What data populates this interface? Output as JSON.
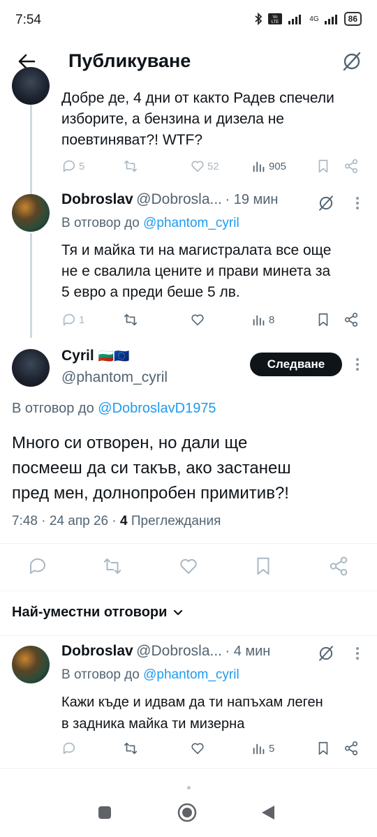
{
  "status_bar": {
    "time": "7:54",
    "network": "4G",
    "battery": "86"
  },
  "header": {
    "title": "Публикуване"
  },
  "tweets": [
    {
      "text_lines": [
        "Добре де, 4 дни от както Радев спечели",
        "изборите, а бензина и дизела не",
        "поевтиняват?! WTF?"
      ],
      "replies": "5",
      "likes": "52",
      "views": "905"
    },
    {
      "name": "Dobroslav",
      "handle": "@Dobrosla...",
      "time": "· 19 мин",
      "reply_prefix": "В отговор до",
      "reply_mention": "@phantom_cyril",
      "text_lines": [
        "Тя и майка ти на магистралата все още",
        "не е свалила цените и прави минета за",
        "5 евро а преди беше 5 лв."
      ],
      "replies": "1",
      "views": "8"
    }
  ],
  "main_tweet": {
    "name": "Cyril",
    "flags": "🇧🇬🇪🇺",
    "handle": "@phantom_cyril",
    "follow_label": "Следване",
    "reply_prefix": "В отговор до",
    "reply_mention": "@DobroslavD1975",
    "text_lines": [
      "Много си отворен, но дали ще",
      "посмееш да си такъв, ако застанеш",
      "пред мен, долнопробен примитив?!"
    ],
    "time": "7:48 · 24 апр 26 ·",
    "views_count": "4",
    "views_label": "Преглеждания"
  },
  "sort": {
    "label": "Най-уместни отговори"
  },
  "reply": {
    "name": "Dobroslav",
    "handle": "@Dobrosla...",
    "time": "· 4 мин",
    "reply_prefix": "В отговор до",
    "reply_mention": "@phantom_cyril",
    "text_lines": [
      "Кажи къде и идвам да ти напъхам леген",
      "в задника майка ти мизерна"
    ],
    "views": "5"
  },
  "colors": {
    "text": "#0f1419",
    "secondary": "#536471",
    "accent": "#1d9bf0",
    "follow_bg": "#0f1419"
  }
}
